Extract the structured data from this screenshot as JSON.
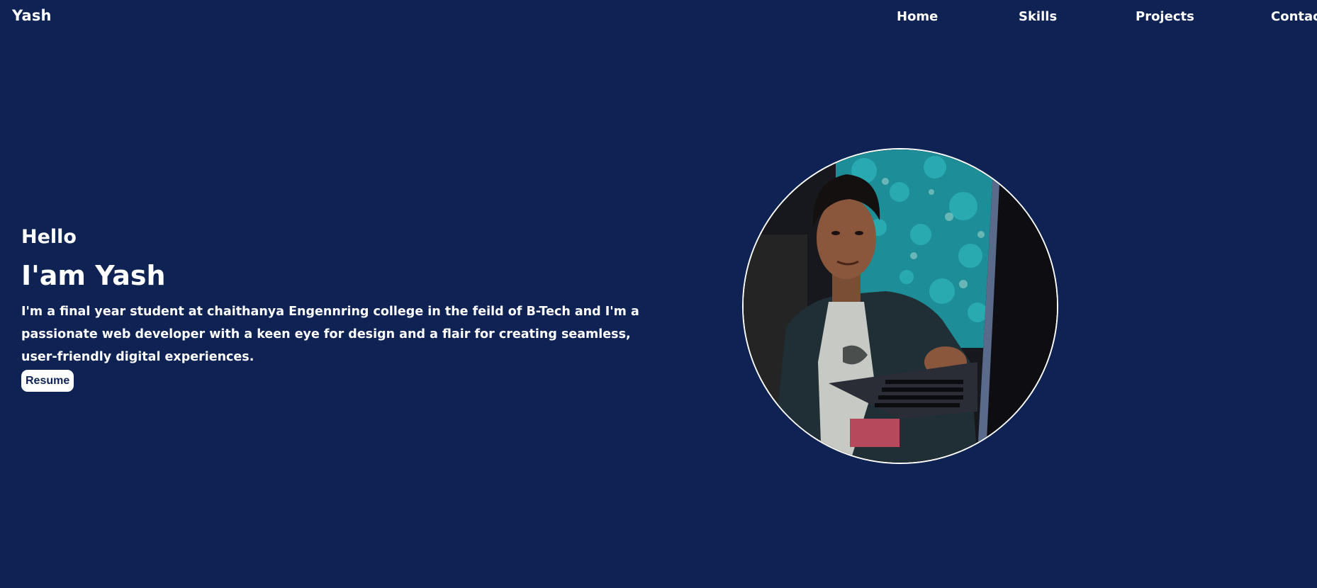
{
  "brand": "Yash",
  "nav": {
    "home": "Home",
    "skills": "Skills",
    "projects": "Projects",
    "contact": "Contact"
  },
  "hero": {
    "greeting": "Hello",
    "headline": "I'am Yash",
    "bio": "I'm a final year student at chaithanya Engennring college in the feild of B-Tech and I'm a passionate web developer with a keen eye for design and a flair for creating seamless, user-friendly digital experiences.",
    "resume_label": "Resume"
  },
  "colors": {
    "background": "#0e2354",
    "text": "#ffffff",
    "button_bg": "#ffffff",
    "button_text": "#0e2354"
  }
}
